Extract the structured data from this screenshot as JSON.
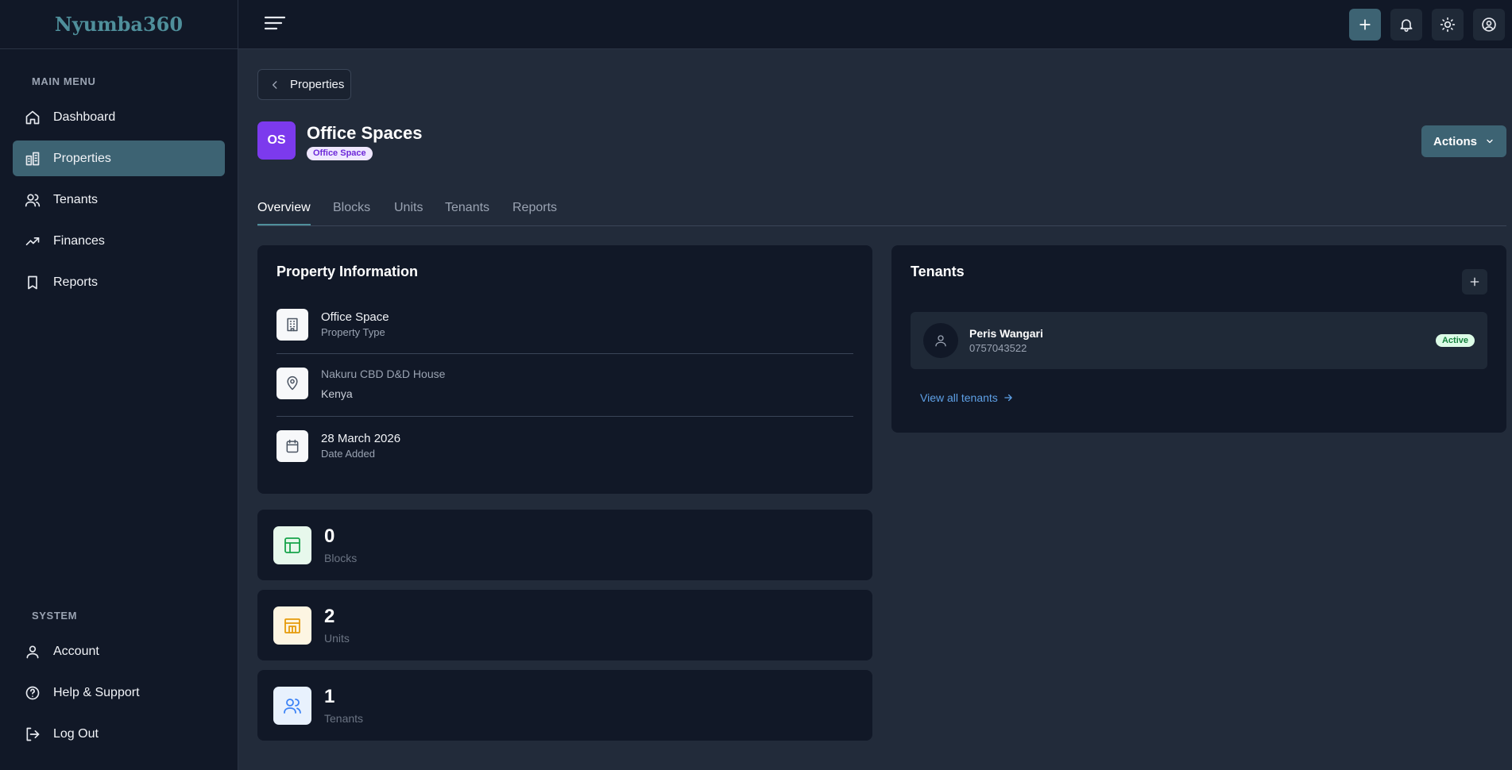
{
  "app": {
    "name": "Nyumba360"
  },
  "sidebar": {
    "main_menu_label": "MAIN MENU",
    "main_items": [
      {
        "label": "Dashboard",
        "icon": "home-icon"
      },
      {
        "label": "Properties",
        "icon": "buildings-icon",
        "active": true
      },
      {
        "label": "Tenants",
        "icon": "users-icon"
      },
      {
        "label": "Finances",
        "icon": "trending-up-icon"
      },
      {
        "label": "Reports",
        "icon": "bookmark-icon"
      }
    ],
    "system_label": "SYSTEM",
    "system_items": [
      {
        "label": "Account",
        "icon": "user-icon"
      },
      {
        "label": "Help & Support",
        "icon": "help-circle-icon"
      },
      {
        "label": "Log Out",
        "icon": "logout-icon"
      }
    ]
  },
  "topbar": {
    "icons": [
      "menu-icon",
      "plus-icon",
      "bell-icon",
      "sun-icon",
      "user-circle-icon"
    ]
  },
  "page": {
    "back_label": "Properties",
    "avatar_initials": "OS",
    "title": "Office Spaces",
    "type_badge": "Office Space",
    "actions_label": "Actions",
    "tabs": [
      "Overview",
      "Blocks",
      "Units",
      "Tenants",
      "Reports"
    ],
    "active_tab": "Overview"
  },
  "property_info": {
    "title": "Property Information",
    "type_value": "Office Space",
    "type_label": "Property Type",
    "address_line1": "Nakuru CBD D&D House",
    "address_line2": "Kenya",
    "date_value": "28 March 2026",
    "date_label": "Date Added"
  },
  "stats": [
    {
      "value": "0",
      "label": "Blocks",
      "color": "#16a34a",
      "bg": "#e7f8ec"
    },
    {
      "value": "2",
      "label": "Units",
      "color": "#e59b0b",
      "bg": "#fdf5e2"
    },
    {
      "value": "1",
      "label": "Tenants",
      "color": "#3b82f6",
      "bg": "#e8f1fd"
    }
  ],
  "tenants_card": {
    "title": "Tenants",
    "tenants": [
      {
        "name": "Peris Wangari",
        "phone": "0757043522",
        "status": "Active"
      }
    ],
    "view_all_label": "View all tenants"
  },
  "colors": {
    "accent": "#3d6373",
    "brand": "#4f8f9b",
    "badge_purple": "#7c3aed",
    "link": "#5ea0e6"
  }
}
